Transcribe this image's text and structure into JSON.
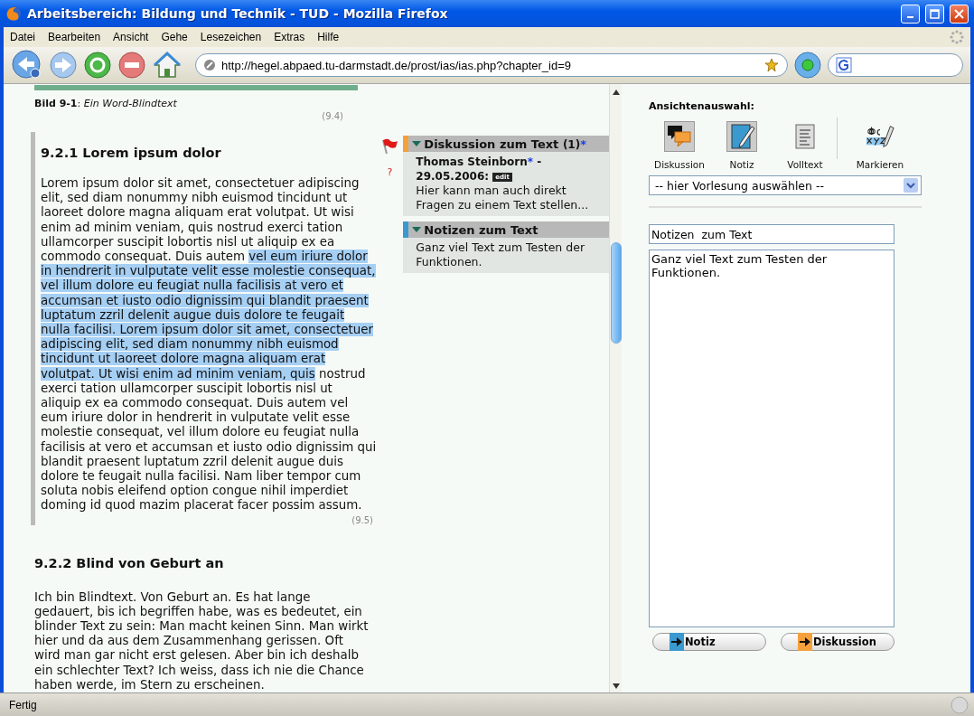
{
  "window": {
    "title": "Arbeitsbereich: Bildung und Technik - TUD - Mozilla Firefox"
  },
  "menu": [
    "Datei",
    "Bearbeiten",
    "Ansicht",
    "Gehe",
    "Lesezeichen",
    "Extras",
    "Hilfe"
  ],
  "address_bar": {
    "value": "http://hegel.abpaed.tu-darmstadt.de/prost/ias/ias.php?chapter_id=9"
  },
  "document": {
    "caption": "**Bild 9-1**: *Ein Word-Blindtext*",
    "caption_number": "(9.4)",
    "section_1": {
      "heading": "9.2.1 Lorem ipsum dolor",
      "number": "(9.5)",
      "segments": [
        {
          "text": "Lorem ipsum dolor sit amet, consectetuer adipiscing elit, sed diam nonummy nibh euismod tincidunt ut laoreet dolore magna aliquam erat volutpat. Ut wisi enim ad minim veniam, quis nostrud exerci tation ullamcorper suscipit lobortis nisl ut aliquip ex ea commodo consequat. Duis autem ",
          "highlighted": false
        },
        {
          "text": "vel eum iriure dolor in hendrerit in vulputate velit esse molestie consequat, vel illum dolore eu feugiat nulla facilisis at vero et accumsan et iusto odio dignissim qui blandit praesent luptatum zzril delenit augue duis dolore te feugait nulla facilisi. Lorem ipsum dolor sit amet, consectetuer adipiscing elit, sed diam nonummy nibh euismod tincidunt ut laoreet dolore magna aliquam erat volutpat. Ut wisi enim ad minim veniam, quis",
          "highlighted": true
        },
        {
          "text": " nostrud exerci tation ullamcorper suscipit lobortis nisl ut aliquip ex ea commodo consequat. Duis autem vel eum iriure dolor in hendrerit in vulputate velit esse molestie consequat, vel illum dolore eu feugiat nulla facilisis at vero et accumsan et iusto odio dignissim qui blandit praesent luptatum zzril delenit augue duis dolore te feugait nulla facilisi. Nam liber tempor cum soluta nobis eleifend option congue nihil imperdiet doming id quod mazim placerat facer possim assum.",
          "highlighted": false
        }
      ],
      "question_mark": "?"
    },
    "section_2": {
      "heading": "9.2.2 Blind von Geburt an",
      "paragraph": "Ich bin Blindtext. Von Geburt an. Es hat lange gedauert, bis ich begriffen habe, was es bedeutet, ein blinder Text zu sein: Man macht keinen Sinn. Man wirkt hier und da aus dem Zusammenhang gerissen. Oft wird man gar nicht erst gelesen. Aber bin ich deshalb ein schlechter Text? Ich weiss, dass ich nie die Chance haben werde, im Stern zu erscheinen."
    }
  },
  "annotations": [
    {
      "kind": "discussion",
      "color": "#f4a03c",
      "title": "Diskussion zum Text",
      "count": "(1)",
      "marker": "*",
      "author": "Thomas Steinborn",
      "author_marker": "*",
      "separator": "-",
      "date": "29.05.2006:",
      "edit": "edit",
      "text": "Hier kann man auch direkt Fragen zu einem Text stellen..."
    },
    {
      "kind": "note",
      "color": "#3a9ad0",
      "title": "Notizen zum Text",
      "text": "Ganz viel Text zum Testen der Funktionen."
    }
  ],
  "sidebar": {
    "heading": "Ansichtenauswahl:",
    "views": [
      {
        "kind": "discussion",
        "label": "Diskussion",
        "selected": true
      },
      {
        "kind": "note",
        "label": "Notiz",
        "selected": true
      },
      {
        "kind": "fulltext",
        "label": "Volltext",
        "selected": false
      },
      {
        "kind": "mark",
        "label": "Markieren",
        "selected": false
      }
    ],
    "lecture_select": {
      "value": "-- hier Vorlesung auswählen --"
    },
    "note_title": {
      "value": "Notizen  zum Text"
    },
    "note_body": {
      "value": "Ganz viel Text zum Testen der Funktionen."
    },
    "buttons": [
      {
        "label": "Notiz",
        "color": "#3a9ad0"
      },
      {
        "label": "Diskussion",
        "color": "#f4a03c"
      }
    ]
  },
  "status_bar": {
    "text": "Fertig"
  }
}
